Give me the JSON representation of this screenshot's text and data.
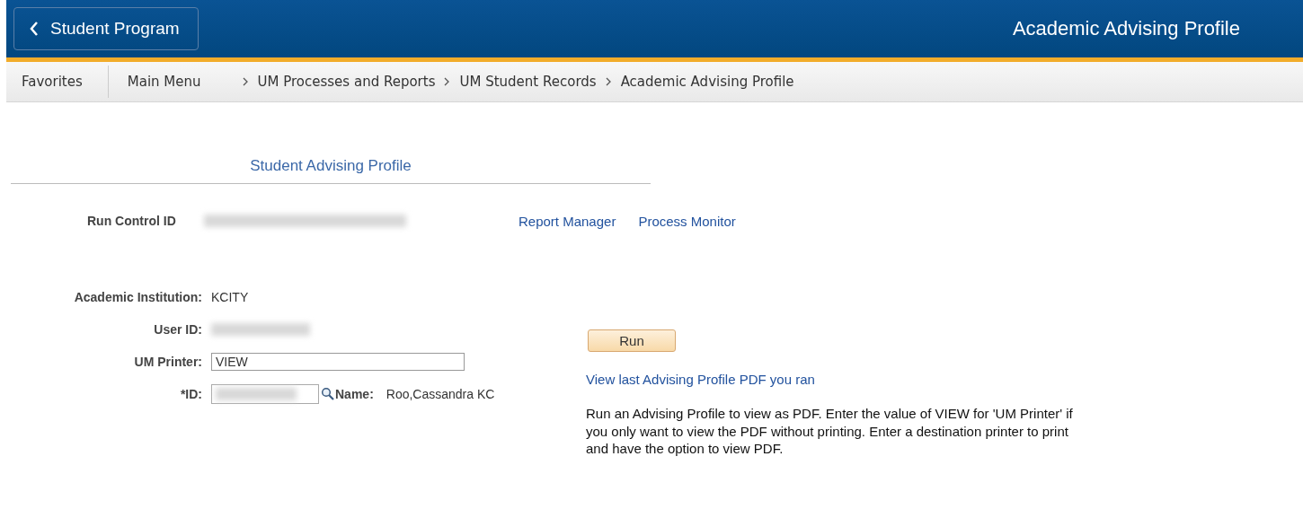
{
  "header": {
    "back_button": "Student Program",
    "title": "Academic Advising Profile"
  },
  "nav": {
    "favorites": "Favorites",
    "main_menu": "Main Menu",
    "breadcrumbs": [
      "UM Processes and Reports",
      "UM Student Records",
      "Academic Advising Profile"
    ]
  },
  "section_title": "Student Advising Profile",
  "run_control": {
    "label": "Run Control ID",
    "links": [
      "Report Manager",
      "Process Monitor"
    ]
  },
  "fields": [
    {
      "kind": "text",
      "label": "Academic Institution:",
      "value": "KCITY"
    },
    {
      "kind": "redacted",
      "label": "User ID:"
    },
    {
      "kind": "input",
      "label": "UM Printer:",
      "value": "VIEW"
    },
    {
      "kind": "lookup",
      "label": "*ID:",
      "name_label": "Name:",
      "name_value": "Roo,Cassandra KC"
    }
  ],
  "run_button": "Run",
  "pdf_link": "View last Advising Profile PDF you ran",
  "help_text": "Run an Advising Profile to view as PDF. Enter the value of VIEW for 'UM Printer' if you only want to view the PDF without printing. Enter a destination printer to print and have the option to view PDF."
}
